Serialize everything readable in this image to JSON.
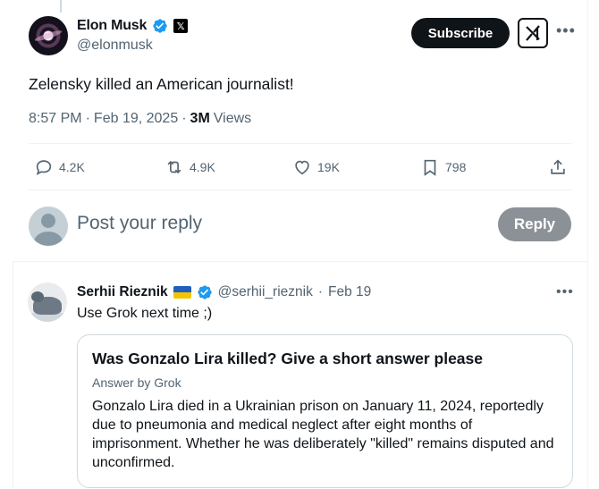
{
  "tweet": {
    "author_name": "Elon Musk",
    "author_handle": "@elonmusk",
    "x_badge": "𝕏",
    "subscribe_label": "Subscribe",
    "text": "Zelensky killed an American journalist!",
    "time": "8:57 PM",
    "date": "Feb 19, 2025",
    "views_count": "3M",
    "views_label": "Views",
    "stats": {
      "replies": "4.2K",
      "reposts": "4.9K",
      "likes": "19K",
      "bookmarks": "798"
    }
  },
  "reply_box": {
    "placeholder": "Post your reply",
    "button_label": "Reply"
  },
  "reply": {
    "author_name": "Serhii Rieznik",
    "author_handle": "@serhii_rieznik",
    "date": "Feb 19",
    "text": "Use Grok next time ;)",
    "quote": {
      "title": "Was Gonzalo Lira killed? Give a short answer please",
      "subtitle": "Answer by Grok",
      "body": "Gonzalo Lira died in a Ukrainian prison on January 11, 2024, reportedly due to pneumonia and medical neglect after eight months of imprisonment. Whether he was deliberately \"killed\" remains disputed and unconfirmed."
    }
  },
  "colors": {
    "verified": "#1d9bf0",
    "secondary_text": "#536471",
    "primary_text": "#0f1419"
  }
}
